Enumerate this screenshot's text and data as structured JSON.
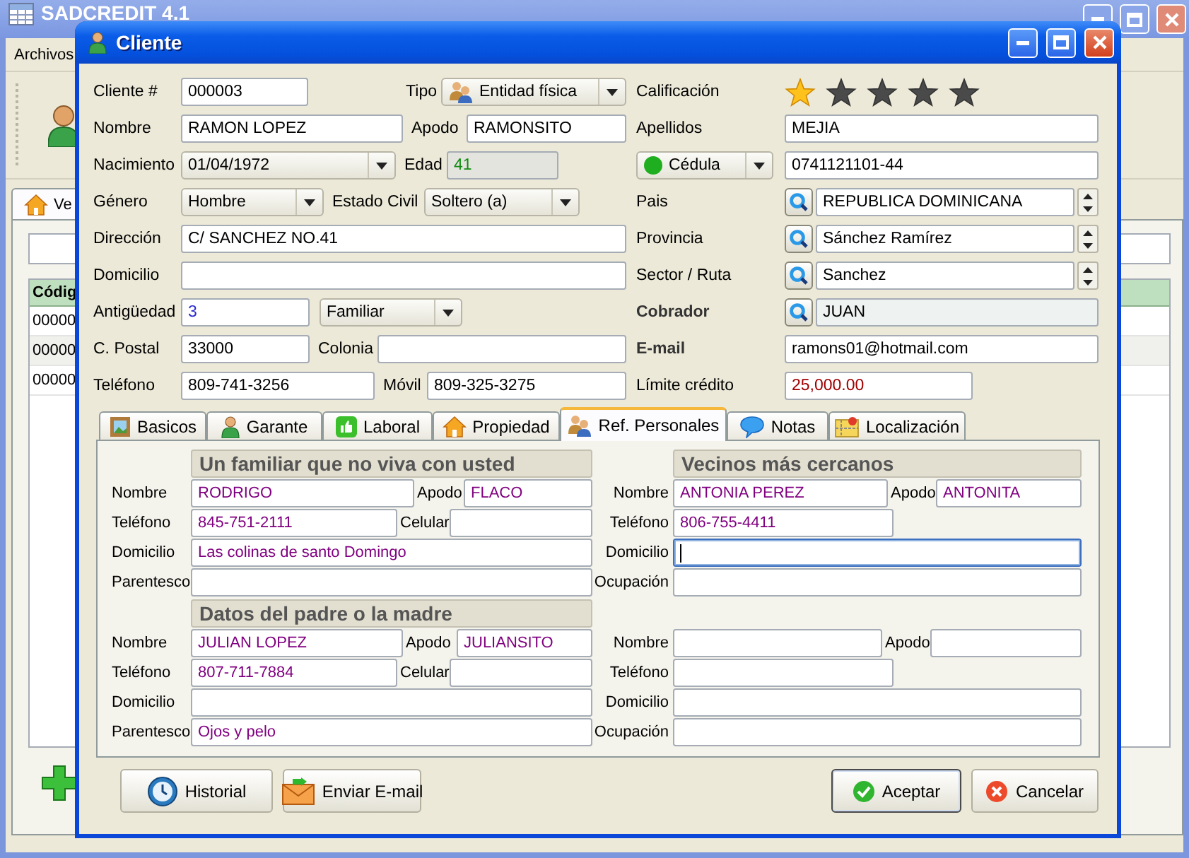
{
  "app_window": {
    "title": "SADCREDIT 4.1",
    "menu": [
      "Archivos"
    ],
    "tab": "Ve",
    "table": {
      "columns": [
        "Códig"
      ],
      "rows": [
        [
          "00000"
        ],
        [
          "00000"
        ],
        [
          "00000"
        ]
      ]
    }
  },
  "dialog": {
    "title": "Cliente",
    "left_rows": [
      [
        {
          "kind": "label",
          "text": "Cliente #"
        },
        {
          "kind": "text",
          "value": "000003"
        },
        {
          "kind": "label",
          "text": "Tipo"
        },
        {
          "kind": "combo",
          "value": "Entidad física"
        }
      ],
      [
        {
          "kind": "label",
          "text": "Nombre"
        },
        {
          "kind": "text",
          "value": "RAMON LOPEZ"
        },
        {
          "kind": "label",
          "text": "Apodo"
        },
        {
          "kind": "text",
          "value": "RAMONSITO"
        }
      ],
      [
        {
          "kind": "label",
          "text": "Nacimiento"
        },
        {
          "kind": "combo",
          "value": "01/04/1972"
        },
        {
          "kind": "label",
          "text": "Edad"
        },
        {
          "kind": "text",
          "value": "41",
          "readonly": true
        }
      ],
      [
        {
          "kind": "label",
          "text": "Género"
        },
        {
          "kind": "combo",
          "value": "Hombre"
        },
        {
          "kind": "label",
          "text": "Estado Civil"
        },
        {
          "kind": "combo",
          "value": "Soltero (a)"
        }
      ],
      [
        {
          "kind": "label",
          "text": "Dirección"
        },
        {
          "kind": "text",
          "value": "C/ SANCHEZ NO.41"
        }
      ],
      [
        {
          "kind": "label",
          "text": "Domicilio"
        },
        {
          "kind": "text"
        }
      ],
      [
        {
          "kind": "label",
          "text": "Antigüedad"
        },
        {
          "kind": "text",
          "value": "3"
        },
        {
          "kind": "combo",
          "value": "Familiar"
        }
      ],
      [
        {
          "kind": "label",
          "text": "C. Postal"
        },
        {
          "kind": "text",
          "value": "33000"
        },
        {
          "kind": "label",
          "text": "Colonia"
        },
        {
          "kind": "text"
        }
      ],
      [
        {
          "kind": "label",
          "text": "Teléfono"
        },
        {
          "kind": "text",
          "value": "809-741-3256"
        },
        {
          "kind": "label",
          "text": "Móvil"
        },
        {
          "kind": "text",
          "value": "809-325-3275"
        }
      ]
    ],
    "right_rows": [
      [
        {
          "kind": "label",
          "text": "Calificación"
        },
        {
          "kind": "stars",
          "stars": 1
        }
      ],
      [
        {
          "kind": "label",
          "text": "Apellidos"
        },
        {
          "kind": "text",
          "value": "MEJIA"
        }
      ],
      [
        {
          "kind": "combo",
          "value": "Cédula"
        },
        {
          "kind": "text",
          "value": "0741121101-44"
        }
      ],
      [
        {
          "kind": "label",
          "text": "Pais"
        },
        {
          "kind": "lookup",
          "value": "REPUBLICA DOMINICANA",
          "spinner": true
        }
      ],
      [
        {
          "kind": "label",
          "text": "Provincia"
        },
        {
          "kind": "lookup",
          "value": "Sánchez Ramírez",
          "spinner": true
        }
      ],
      [
        {
          "kind": "label",
          "text": "Sector / Ruta"
        },
        {
          "kind": "lookup",
          "value": "Sanchez",
          "spinner": true
        }
      ],
      [
        {
          "kind": "label",
          "text": "Cobrador",
          "bold": true
        },
        {
          "kind": "lookup",
          "value": "JUAN",
          "spinner": false,
          "readonly": true
        }
      ],
      [
        {
          "kind": "label",
          "text": "E-mail",
          "bold": true
        },
        {
          "kind": "text",
          "value": "ramons01@hotmail.com"
        }
      ],
      [
        {
          "kind": "label",
          "text": "Límite crédito"
        },
        {
          "kind": "text",
          "value": "25,000.00"
        }
      ]
    ],
    "tabs": [
      {
        "label": "Basicos",
        "selected": false
      },
      {
        "label": "Garante",
        "selected": false
      },
      {
        "label": "Laboral",
        "selected": false
      },
      {
        "label": "Propiedad",
        "selected": false
      },
      {
        "label": "Ref. Personales",
        "selected": true
      },
      {
        "label": "Notas",
        "selected": false
      },
      {
        "label": "Localización",
        "selected": false
      }
    ],
    "ref_groups": [
      {
        "heading": "Un familiar que no viva con usted",
        "rows": [
          [
            {
              "kind": "label",
              "text": "Nombre"
            },
            {
              "kind": "text",
              "value": "RODRIGO"
            },
            {
              "kind": "label",
              "text": "Apodo"
            },
            {
              "kind": "text",
              "value": "FLACO"
            }
          ],
          [
            {
              "kind": "label",
              "text": "Teléfono"
            },
            {
              "kind": "text",
              "value": "845-751-2111"
            },
            {
              "kind": "label",
              "text": "Celular"
            },
            {
              "kind": "text"
            }
          ],
          [
            {
              "kind": "label",
              "text": "Domicilio"
            },
            {
              "kind": "text",
              "value": "Las colinas de santo Domingo"
            }
          ],
          [
            {
              "kind": "label",
              "text": "Parentesco"
            },
            {
              "kind": "text"
            }
          ]
        ]
      },
      {
        "heading": "Vecinos más cercanos",
        "rows": [
          [
            {
              "kind": "label",
              "text": "Nombre"
            },
            {
              "kind": "text",
              "value": "ANTONIA PEREZ"
            },
            {
              "kind": "label",
              "text": "Apodo"
            },
            {
              "kind": "text",
              "value": "ANTONITA"
            }
          ],
          [
            {
              "kind": "label",
              "text": "Teléfono"
            },
            {
              "kind": "text",
              "value": "806-755-4411"
            }
          ],
          [
            {
              "kind": "label",
              "text": "Domicilio"
            },
            {
              "kind": "text",
              "focused": true
            }
          ],
          [
            {
              "kind": "label",
              "text": "Ocupación"
            },
            {
              "kind": "text"
            }
          ]
        ]
      },
      {
        "heading": "Datos del padre o la madre",
        "rows": [
          [
            {
              "kind": "label",
              "text": "Nombre"
            },
            {
              "kind": "text",
              "value": "JULIAN LOPEZ"
            },
            {
              "kind": "label",
              "text": "Apodo"
            },
            {
              "kind": "text",
              "value": "JULIANSITO"
            }
          ],
          [
            {
              "kind": "label",
              "text": "Teléfono"
            },
            {
              "kind": "text",
              "value": "807-711-7884"
            },
            {
              "kind": "label",
              "text": "Celular"
            },
            {
              "kind": "text"
            }
          ],
          [
            {
              "kind": "label",
              "text": "Domicilio"
            },
            {
              "kind": "text"
            }
          ],
          [
            {
              "kind": "label",
              "text": "Parentesco"
            },
            {
              "kind": "text",
              "value": "Ojos y pelo"
            }
          ]
        ]
      },
      {
        "rows": [
          [
            {
              "kind": "label",
              "text": "Nombre"
            },
            {
              "kind": "text"
            },
            {
              "kind": "label",
              "text": "Apodo"
            },
            {
              "kind": "text"
            }
          ],
          [
            {
              "kind": "label",
              "text": "Teléfono"
            },
            {
              "kind": "text"
            }
          ],
          [
            {
              "kind": "label",
              "text": "Domicilio"
            },
            {
              "kind": "text"
            }
          ],
          [
            {
              "kind": "label",
              "text": "Ocupación"
            },
            {
              "kind": "text"
            }
          ]
        ]
      }
    ],
    "buttons_left": [
      {
        "label": "Historial"
      },
      {
        "label": "Enviar E-mail"
      }
    ],
    "buttons_right": [
      {
        "label": "Aceptar",
        "default": true
      },
      {
        "label": "Cancelar",
        "default": false
      }
    ]
  }
}
